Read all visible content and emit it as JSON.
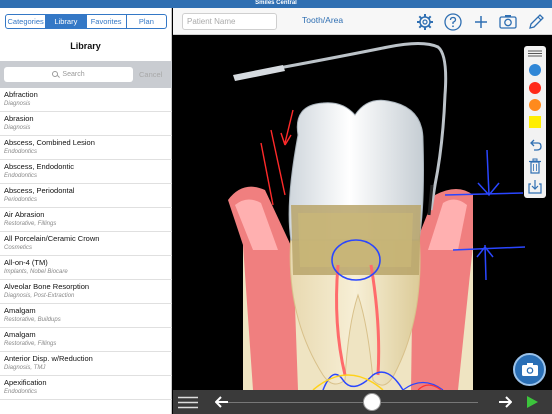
{
  "app": {
    "title": "Smiles Central"
  },
  "sidebar": {
    "tabs": [
      {
        "label": "Categories"
      },
      {
        "label": "Library"
      },
      {
        "label": "Favorites"
      },
      {
        "label": "Plan"
      }
    ],
    "active_tab": "Library",
    "title": "Library",
    "search": {
      "placeholder": "Search",
      "cancel_label": "Cancel"
    },
    "items": [
      {
        "name": "Abfraction",
        "category": "Diagnosis"
      },
      {
        "name": "Abrasion",
        "category": "Diagnosis"
      },
      {
        "name": "Abscess, Combined Lesion",
        "category": "Endodontics"
      },
      {
        "name": "Abscess, Endodontic",
        "category": "Endodontics"
      },
      {
        "name": "Abscess, Periodontal",
        "category": "Periodontics"
      },
      {
        "name": "Air Abrasion",
        "category": "Restorative, Fillings"
      },
      {
        "name": "All Porcelain/Ceramic Crown",
        "category": "Cosmetics"
      },
      {
        "name": "All-on-4 (TM)",
        "category": "Implants, Nobel Biocare"
      },
      {
        "name": "Alveolar Bone Resorption",
        "category": "Diagnosis, Post-Extraction"
      },
      {
        "name": "Amalgam",
        "category": "Restorative, Buildups"
      },
      {
        "name": "Amalgam",
        "category": "Restorative, Fillings"
      },
      {
        "name": "Anterior Disp. w/Reduction",
        "category": "Diagnosis, TMJ"
      },
      {
        "name": "Apexification",
        "category": "Endodontics"
      }
    ]
  },
  "toolbar": {
    "patient_placeholder": "Patient Name",
    "title": "Tooth/Area",
    "icons": [
      "gear-icon",
      "help-icon",
      "add-icon",
      "camera-icon",
      "pencil-icon"
    ]
  },
  "palette": {
    "colors": [
      "#2f86d6",
      "#ff2a1a",
      "#ff8a1c",
      "#ffee00"
    ],
    "tools": [
      "undo-icon",
      "trash-icon",
      "save-icon"
    ]
  },
  "colors": {
    "accent": "#3478c6",
    "titlebar": "#2f6fb2"
  }
}
